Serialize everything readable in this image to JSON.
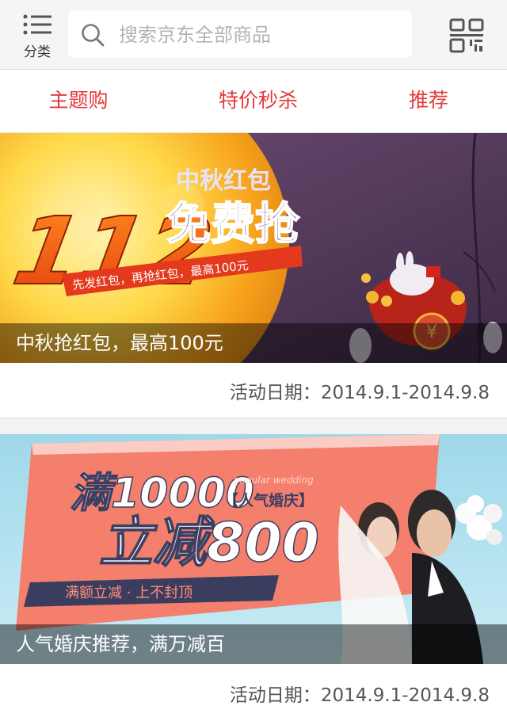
{
  "header": {
    "category_label": "分类",
    "search_placeholder": "搜索京东全部商品"
  },
  "tabs": [
    {
      "label": "主题购"
    },
    {
      "label": "特价秒杀"
    },
    {
      "label": "推荐"
    }
  ],
  "promos": [
    {
      "caption": "中秋抢红包，最高100元",
      "date": "活动日期：2014.9.1-2014.9.8",
      "art": {
        "big_number": "112",
        "title_small": "中秋红包",
        "title_big": "免费抢",
        "ribbon": "先发红包，再抢红包，最高100元"
      }
    },
    {
      "caption": "人气婚庆推荐，满万减百",
      "date": "活动日期：2014.9.1-2014.9.8",
      "art": {
        "line1_prefix": "满10000",
        "small_en": "popular wedding",
        "bracket_label": "【人气婚庆】",
        "line2": "立减800",
        "ribbon": "满额立减 · 上不封顶"
      }
    }
  ],
  "colors": {
    "accent": "#e4393c",
    "caption_overlay": "rgba(0,0,0,0.45)"
  }
}
